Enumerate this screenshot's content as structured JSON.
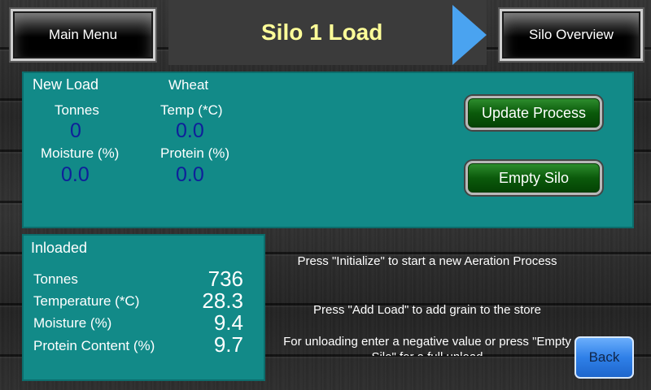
{
  "header": {
    "main_menu_label": "Main Menu",
    "title": "Silo 1 Load",
    "silo_overview_label": "Silo Overview",
    "arrow_icon": "play-arrow-icon"
  },
  "new_load": {
    "heading": "New Load",
    "grain": "Wheat",
    "tonnes_label": "Tonnes",
    "tonnes_value": "0",
    "temp_label": "Temp (*C)",
    "temp_value": "0.0",
    "moisture_label": "Moisture (%)",
    "moisture_value": "0.0",
    "protein_label": "Protein (%)",
    "protein_value": "0.0",
    "update_process_label": "Update Process",
    "empty_silo_label": "Empty Silo"
  },
  "inloaded": {
    "heading": "Inloaded",
    "rows": [
      {
        "label": "Tonnes",
        "value": "736"
      },
      {
        "label": "Temperature (*C)",
        "value": "28.3"
      },
      {
        "label": "Moisture (%)",
        "value": "9.4"
      },
      {
        "label": "Protein Content (%)",
        "value": "9.7"
      }
    ]
  },
  "instructions": {
    "line1": "Press \"Initialize\" to start a new Aeration Process",
    "line2": "Press \"Add Load\" to add grain to the store",
    "line3": "For unloading enter a negative value or press \"Empty Silo\" for a full unload"
  },
  "back_label": "Back",
  "colors": {
    "panel": "#128a88",
    "title": "#ffff99",
    "value_blue": "#0f1f9a",
    "green_button": "#0b5a0b",
    "back_button": "#2f80e8",
    "arrow": "#4aa3f0"
  }
}
